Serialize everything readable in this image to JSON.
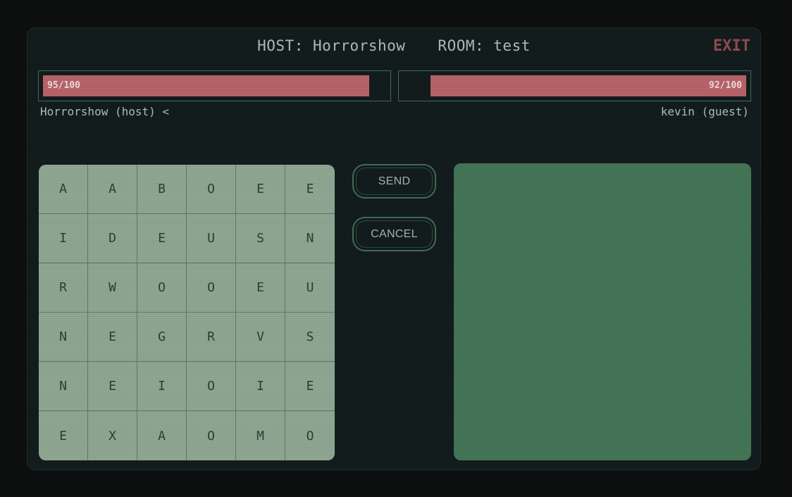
{
  "header": {
    "host_label": "HOST: Horrorshow",
    "room_label": "ROOM: test",
    "exit_label": "EXIT"
  },
  "players": {
    "host": {
      "hp_text": "95/100",
      "hp_value": 95,
      "hp_max": 100,
      "name_label": "Horrorshow (host) <"
    },
    "guest": {
      "hp_text": "92/100",
      "hp_value": 92,
      "hp_max": 100,
      "name_label": "kevin (guest)"
    }
  },
  "grid": {
    "rows": [
      [
        "A",
        "A",
        "B",
        "O",
        "E",
        "E"
      ],
      [
        "I",
        "D",
        "E",
        "U",
        "S",
        "N"
      ],
      [
        "R",
        "W",
        "O",
        "O",
        "E",
        "U"
      ],
      [
        "N",
        "E",
        "G",
        "R",
        "V",
        "S"
      ],
      [
        "N",
        "E",
        "I",
        "O",
        "I",
        "E"
      ],
      [
        "E",
        "X",
        "A",
        "O",
        "M",
        "O"
      ]
    ]
  },
  "actions": {
    "send_label": "SEND",
    "cancel_label": "CANCEL"
  },
  "colors": {
    "background": "#0d0e0e",
    "frame": "#111a1b",
    "accent_green": "#447556",
    "hp_red": "#b9636a",
    "exit_red": "#8c4a4e",
    "grid_tile": "#8fa792"
  }
}
